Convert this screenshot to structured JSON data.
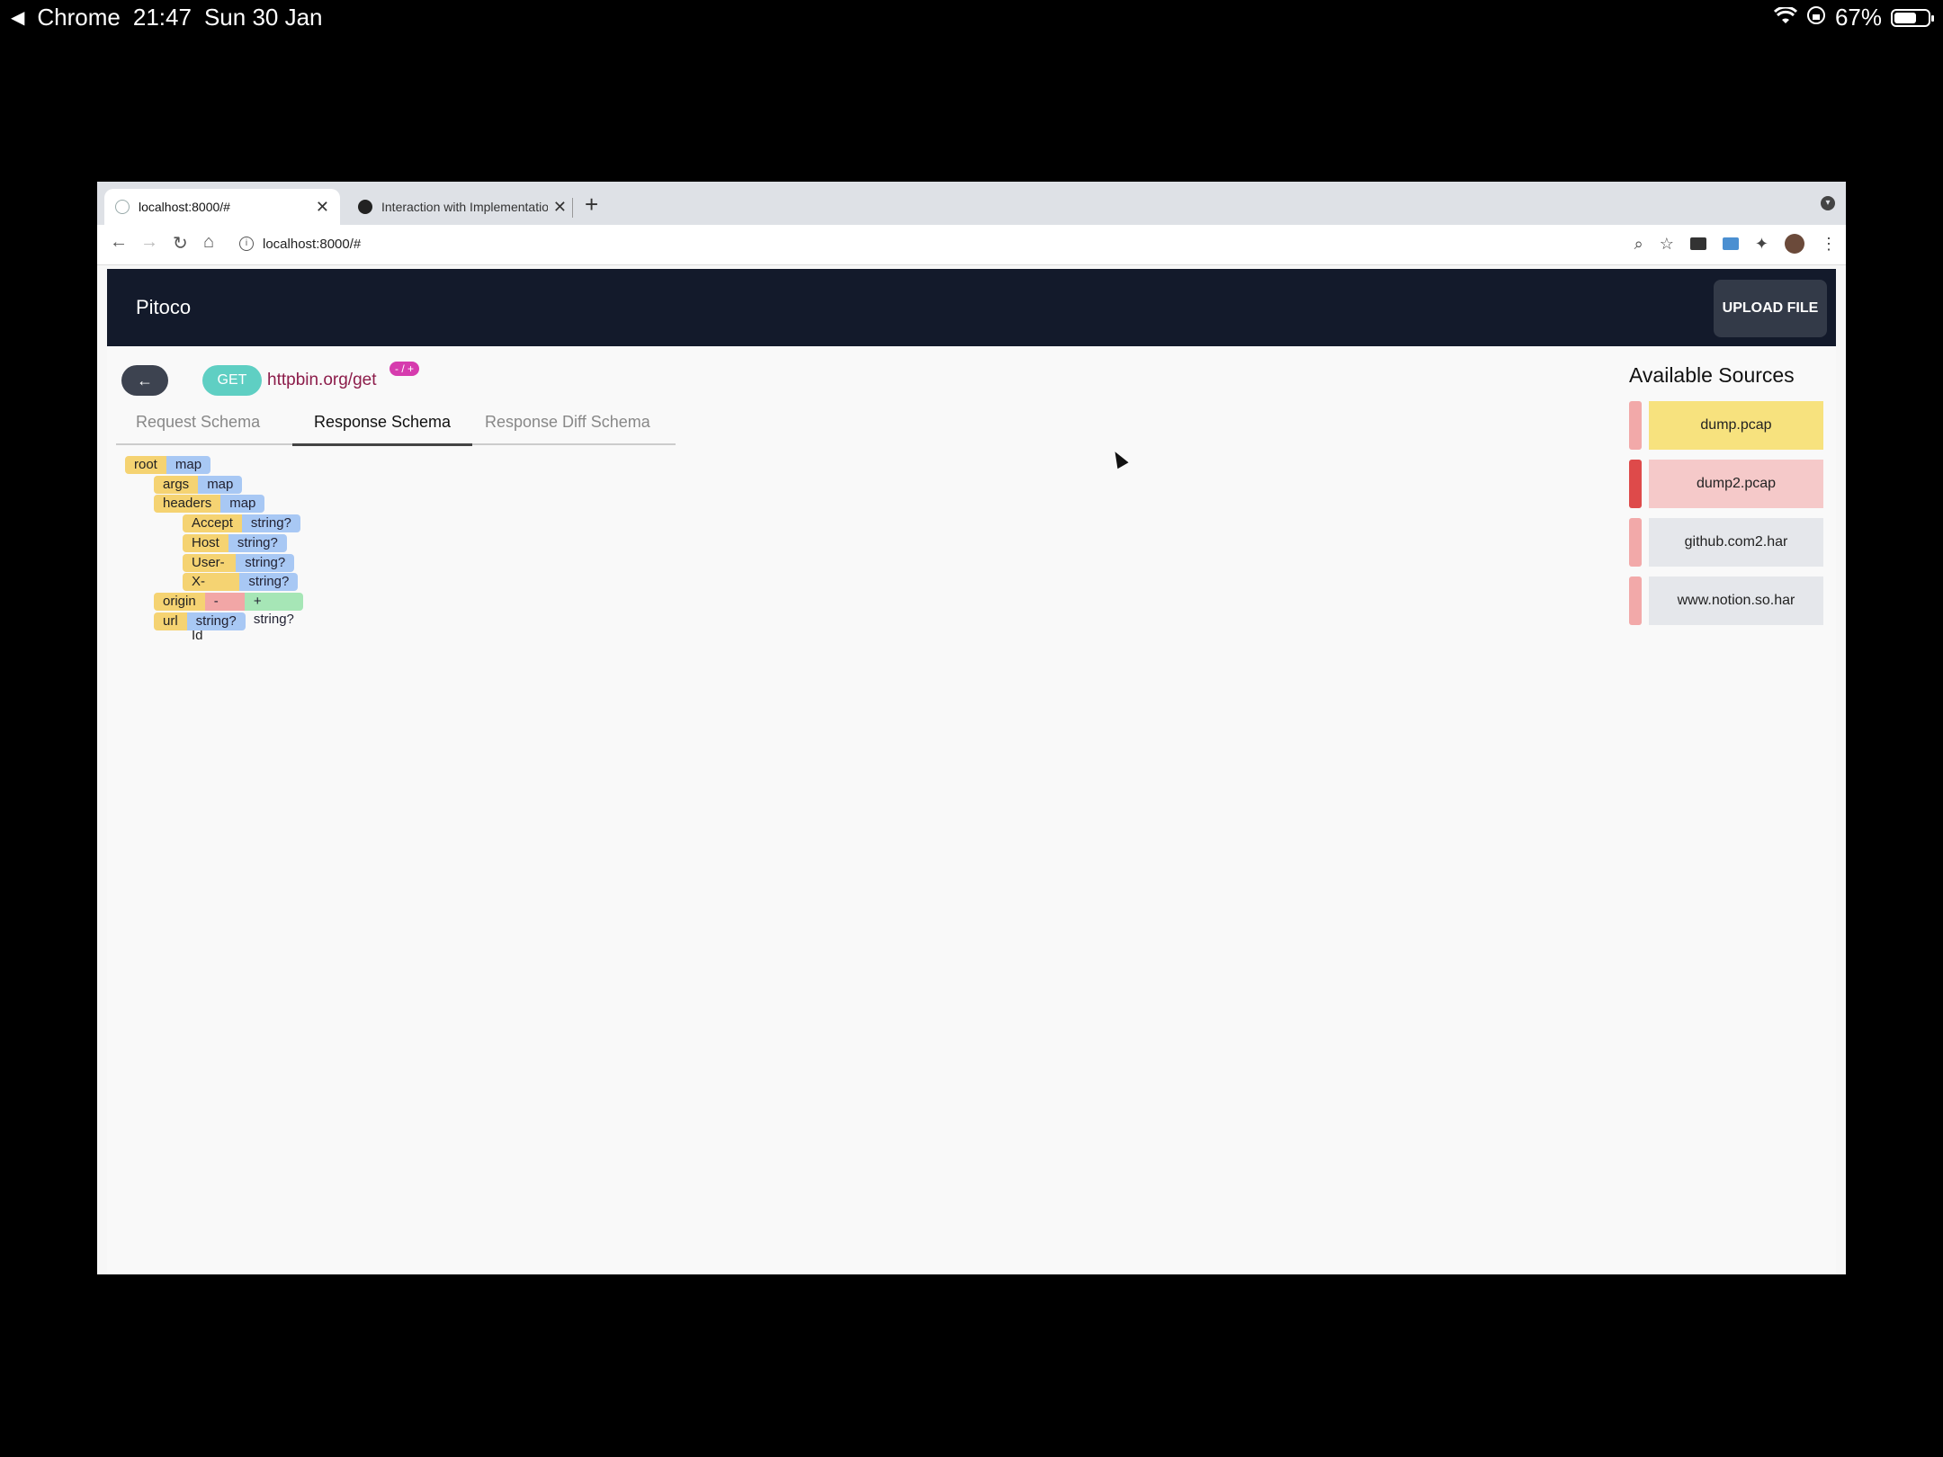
{
  "status_bar": {
    "app": "Chrome",
    "time": "21:47",
    "date": "Sun 30 Jan",
    "battery": "67%",
    "battery_level": 0.67
  },
  "browser": {
    "tabs": [
      {
        "title": "localhost:8000/#",
        "favicon": "localhost-icon"
      },
      {
        "title": "Interaction with Implementation",
        "favicon": "github-icon"
      }
    ],
    "url": "localhost:8000/#"
  },
  "app": {
    "brand": "Pitoco",
    "upload_label": "UPLOAD FILE",
    "method": "GET",
    "endpoint": "httpbin.org/get",
    "diff_badge": "- / +",
    "schema_tabs": [
      "Request Schema",
      "Response Schema",
      "Response Diff Schema"
    ],
    "selected_tab": "Response Schema",
    "tree": [
      {
        "key": "root",
        "types": [
          {
            "label": "map",
            "kind": "type"
          }
        ]
      },
      {
        "key": "args",
        "types": [
          {
            "label": "map",
            "kind": "type"
          }
        ]
      },
      {
        "key": "headers",
        "types": [
          {
            "label": "map",
            "kind": "type"
          }
        ]
      },
      {
        "key": "Accept",
        "types": [
          {
            "label": "string?",
            "kind": "type"
          }
        ]
      },
      {
        "key": "Host",
        "types": [
          {
            "label": "string?",
            "kind": "type"
          }
        ]
      },
      {
        "key": "User-Agent",
        "types": [
          {
            "label": "string?",
            "kind": "type"
          }
        ]
      },
      {
        "key": "X-Amzn-Trace-Id",
        "types": [
          {
            "label": "string?",
            "kind": "type"
          }
        ]
      },
      {
        "key": "origin",
        "types": [
          {
            "label": "- int?",
            "kind": "removed"
          },
          {
            "label": "+ string?",
            "kind": "added"
          }
        ]
      },
      {
        "key": "url",
        "types": [
          {
            "label": "string?",
            "kind": "type"
          }
        ]
      }
    ],
    "sources_title": "Available Sources",
    "sources": [
      {
        "name": "dump.pcap",
        "bar_color": "#f2a9a9",
        "bg_color": "#f7e27e"
      },
      {
        "name": "dump2.pcap",
        "bar_color": "#de4a4a",
        "bg_color": "#f5c9c9"
      },
      {
        "name": "github.com2.har",
        "bar_color": "#f2a9a9",
        "bg_color": "#e5e7eb"
      },
      {
        "name": "www.notion.so.har",
        "bar_color": "#f2a9a9",
        "bg_color": "#e5e7eb"
      }
    ]
  }
}
